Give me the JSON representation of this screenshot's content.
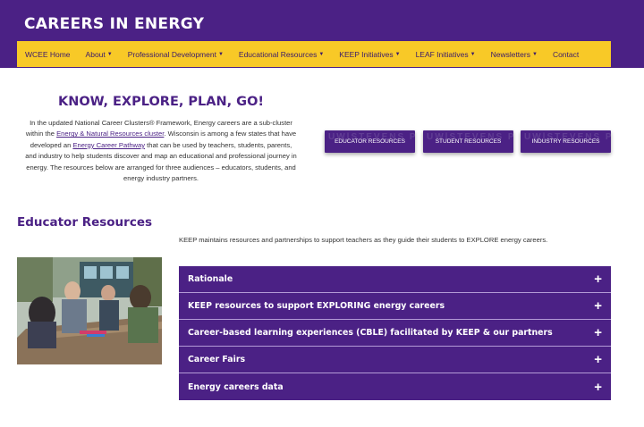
{
  "header": {
    "title": "CAREERS IN ENERGY"
  },
  "nav": {
    "items": [
      {
        "label": "WCEE Home",
        "has_caret": false
      },
      {
        "label": "About",
        "has_caret": true
      },
      {
        "label": "Professional Development",
        "has_caret": true
      },
      {
        "label": "Educational Resources",
        "has_caret": true
      },
      {
        "label": "KEEP Initiatives",
        "has_caret": true
      },
      {
        "label": "LEAF Initiatives",
        "has_caret": true
      },
      {
        "label": "Newsletters",
        "has_caret": true
      },
      {
        "label": "Contact",
        "has_caret": false
      }
    ],
    "caret_glyph": "▼"
  },
  "intro": {
    "heading": "KNOW, EXPLORE, PLAN, GO!",
    "text_1": "In the updated National Career Clusters® Framework, Energy careers are a sub-cluster within the ",
    "link_1": "Energy & Natural Resources cluster",
    "text_2": ". Wisconsin is among a few states that have developed an ",
    "link_2": "Energy Career Pathway",
    "text_3": " that can be used by teachers, students, parents, and industry to help students discover and map an educational and professional journey in energy. The resources below are arranged for three audiences – educators, students, and energy industry partners."
  },
  "audience_buttons": [
    {
      "label": "EDUCATOR RESOURCES",
      "watermark": "UW|STEVENS POINT"
    },
    {
      "label": "STUDENT RESOURCES",
      "watermark": "UW|STEVENS POINT"
    },
    {
      "label": "INDUSTRY RESOURCES",
      "watermark": "UW|STEVENS POINT"
    }
  ],
  "educator_section": {
    "title": "Educator Resources",
    "description": "KEEP maintains resources and partnerships to support teachers as they guide their students to EXPLORE energy careers.",
    "accordion": [
      {
        "title": "Rationale"
      },
      {
        "title": "KEEP resources to support EXPLORING energy careers"
      },
      {
        "title": "Career-based learning experiences (CBLE) facilitated by KEEP & our partners"
      },
      {
        "title": "Career Fairs"
      },
      {
        "title": "Energy careers data"
      }
    ],
    "expand_glyph": "+"
  },
  "colors": {
    "purple": "#4b2185",
    "gold": "#f8c927"
  }
}
